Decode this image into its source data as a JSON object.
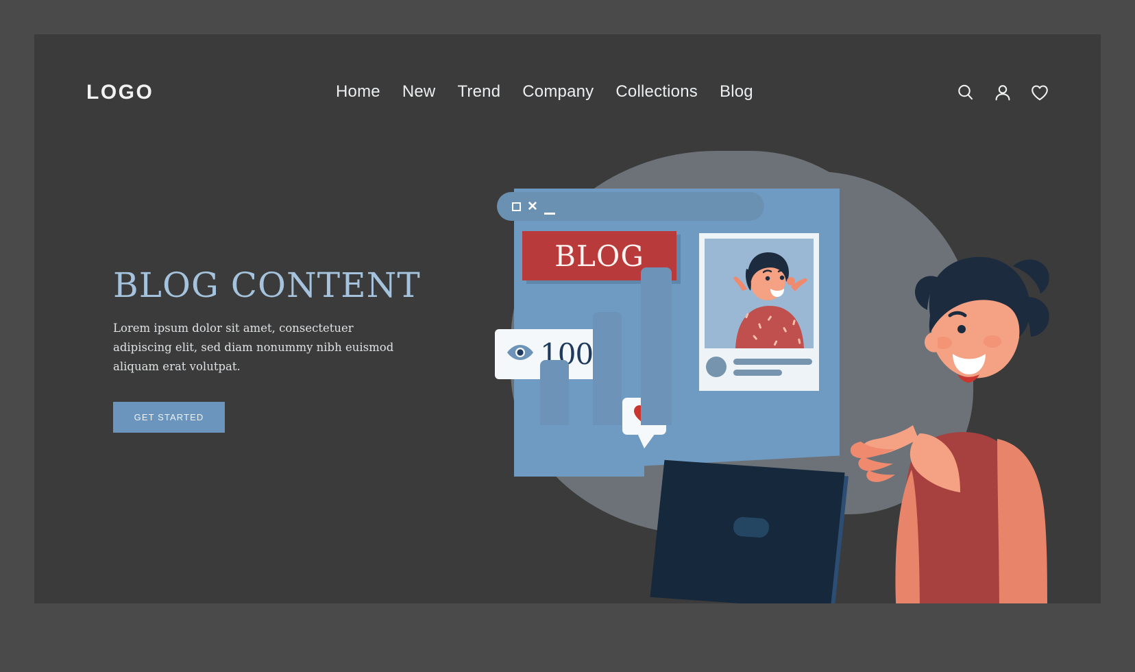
{
  "brand": {
    "logo": "LOGO"
  },
  "nav": {
    "links": [
      {
        "label": "Home"
      },
      {
        "label": "New"
      },
      {
        "label": "Trend"
      },
      {
        "label": "Company"
      },
      {
        "label": "Collections"
      },
      {
        "label": "Blog"
      }
    ],
    "icons": [
      {
        "name": "search-icon"
      },
      {
        "name": "user-icon"
      },
      {
        "name": "heart-icon"
      }
    ]
  },
  "hero": {
    "headline": "BLOG CONTENT",
    "body": "Lorem ipsum dolor sit amet, consectetuer adipiscing elit, sed diam nonummy nibh euismod aliquam erat volutpat.",
    "cta_label": "GET STARTED"
  },
  "illustration": {
    "window": {
      "controls": [
        "maximize",
        "close",
        "minimize"
      ],
      "blog_tag": "BLOG"
    },
    "views_badge": {
      "icon": "eye-icon",
      "count": "100"
    },
    "like_bubble": {
      "icon": "heart-icon"
    }
  },
  "colors": {
    "page_background": "#4a4a4a",
    "hero_background": "#3b3b3b",
    "headline": "#a6c3de",
    "accent_blue": "#6c95bd",
    "accent_red": "#b93a3a",
    "text_light": "#eceff1"
  }
}
